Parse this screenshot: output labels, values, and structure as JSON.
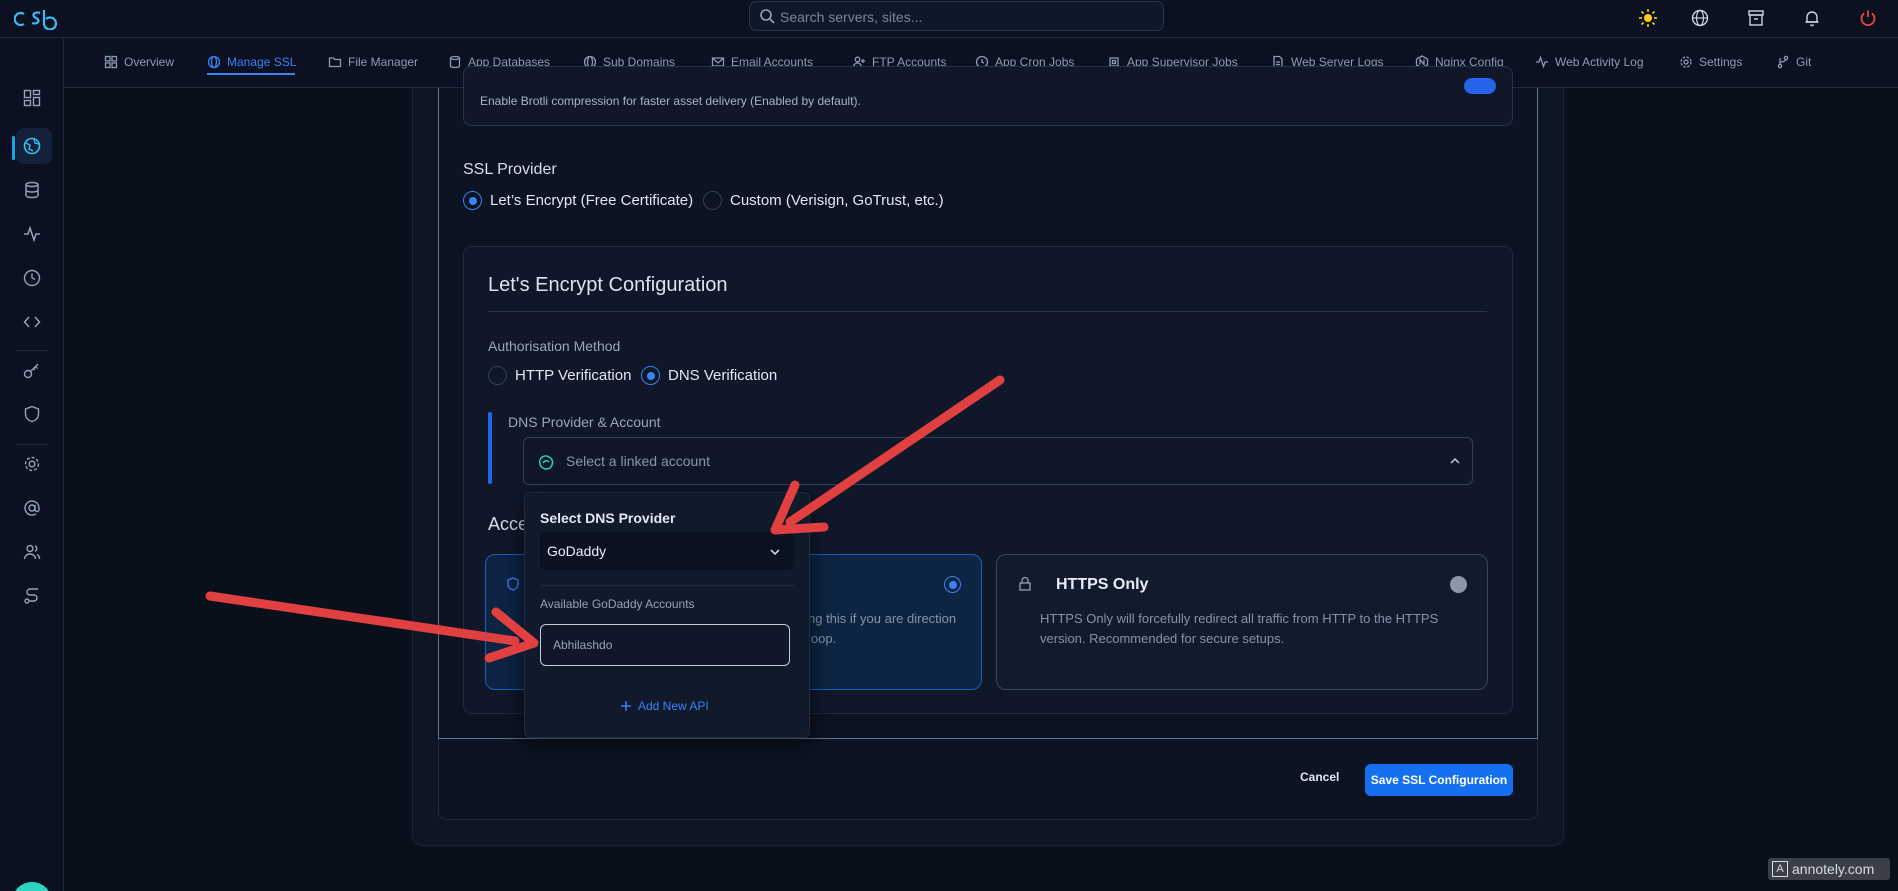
{
  "search": {
    "placeholder": "Search servers, sites..."
  },
  "tabs": [
    {
      "label": "Overview",
      "icon": "grid-icon"
    },
    {
      "label": "Manage SSL",
      "icon": "globe-icon",
      "active": true
    },
    {
      "label": "File Manager",
      "icon": "folder-icon"
    },
    {
      "label": "App Databases",
      "icon": "database-icon"
    },
    {
      "label": "Sub Domains",
      "icon": "globe-icon"
    },
    {
      "label": "Email Accounts",
      "icon": "mail-icon"
    },
    {
      "label": "FTP Accounts",
      "icon": "user-plus-icon"
    },
    {
      "label": "App Cron Jobs",
      "icon": "clock-icon"
    },
    {
      "label": "App Supervisor Jobs",
      "icon": "cpu-icon"
    },
    {
      "label": "Web Server Logs",
      "icon": "file-icon"
    },
    {
      "label": "Nginx Config",
      "icon": "nginx-icon"
    },
    {
      "label": "Web Activity Log",
      "icon": "activity-icon"
    },
    {
      "label": "Settings",
      "icon": "gear-icon"
    },
    {
      "label": "Git",
      "icon": "git-icon"
    }
  ],
  "brotli": {
    "description": "Enable Brotli compression for faster asset delivery (Enabled by default)."
  },
  "ssl_provider": {
    "label": "SSL Provider",
    "options": [
      {
        "label": "Let’s Encrypt (Free Certificate)",
        "checked": true
      },
      {
        "label": "Custom (Verisign, GoTrust, etc.)",
        "checked": false
      }
    ]
  },
  "le_config": {
    "title": "Let's Encrypt Configuration",
    "auth_label": "Authorisation Method",
    "auth_options": [
      {
        "label": "HTTP Verification",
        "checked": false
      },
      {
        "label": "DNS Verification",
        "checked": true
      }
    ],
    "dns_label": "DNS Provider & Account",
    "dns_placeholder": "Select a linked account",
    "access_label_partial": "Acce"
  },
  "access_options": {
    "a": {
      "desc": "ng this if you are direction loop."
    },
    "b": {
      "title": "HTTPS Only",
      "desc": "HTTPS Only will forcefully redirect all traffic from HTTP to the HTTPS version. Recommended for secure setups."
    }
  },
  "popover": {
    "title": "Select DNS Provider",
    "provider": "GoDaddy",
    "sub_label": "Available GoDaddy Accounts",
    "account_value": "Abhilashdo",
    "add_api": "Add New API"
  },
  "actions": {
    "cancel": "Cancel",
    "save": "Save SSL Configuration"
  },
  "watermark": {
    "text": "annotely.com"
  },
  "colors": {
    "accent": "#3b82f6",
    "annotation": "#e04040",
    "background": "#0a0f1c"
  }
}
